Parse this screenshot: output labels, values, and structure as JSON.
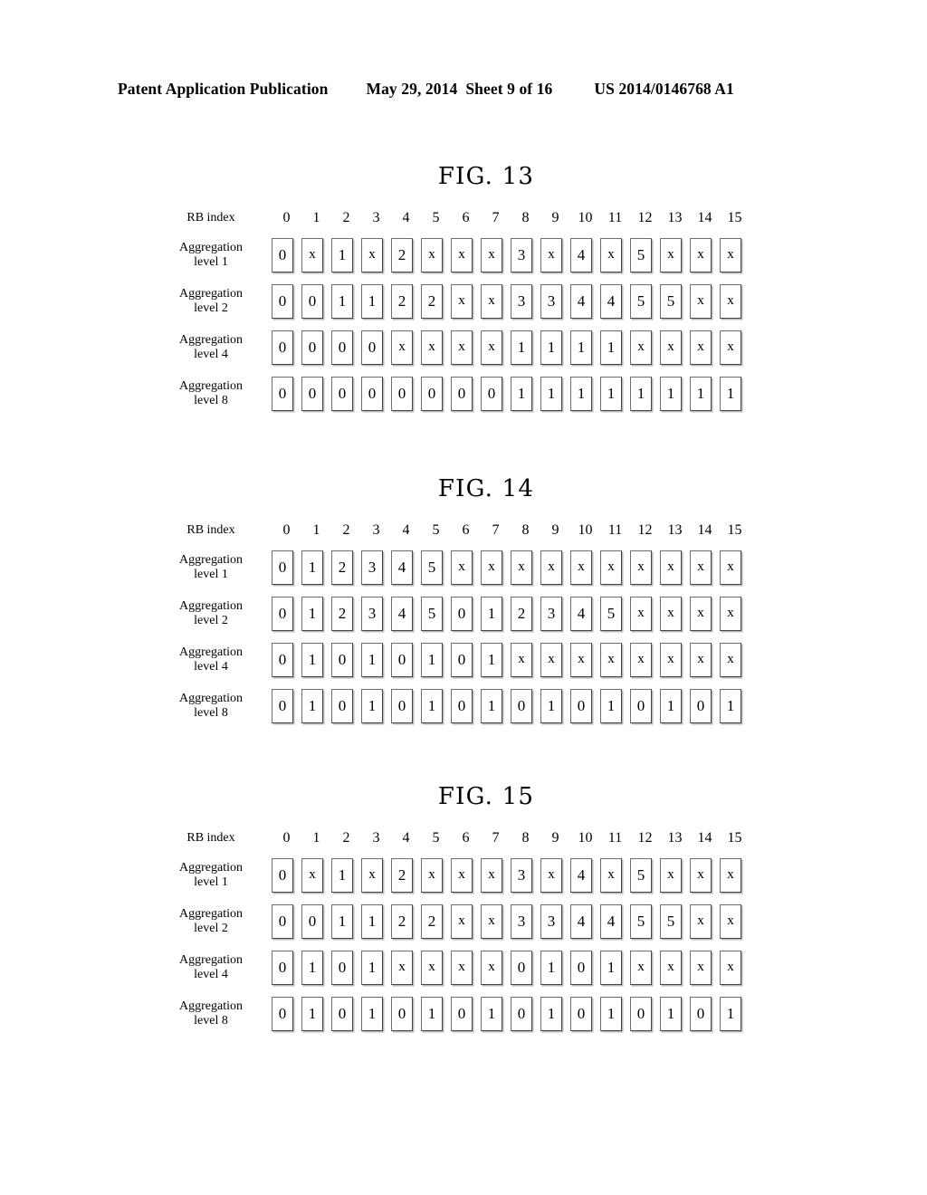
{
  "header": {
    "publication": "Patent Application Publication",
    "date": "May 29, 2014",
    "sheet": "Sheet 9 of 16",
    "patent_number": "US 2014/0146768 A1"
  },
  "common": {
    "rb_index_label": "RB index",
    "aggregation_word": "Aggregation",
    "column_headers": [
      "0",
      "1",
      "2",
      "3",
      "4",
      "5",
      "6",
      "7",
      "8",
      "9",
      "10",
      "11",
      "12",
      "13",
      "14",
      "15"
    ]
  },
  "figures": [
    {
      "id": "fig-13",
      "title": "FIG. 13",
      "rows": [
        {
          "label_line1": "Aggregation",
          "label_line2": "level 1",
          "values": [
            "0",
            "x",
            "1",
            "x",
            "2",
            "x",
            "x",
            "x",
            "3",
            "x",
            "4",
            "x",
            "5",
            "x",
            "x",
            "x"
          ]
        },
        {
          "label_line1": "Aggregation",
          "label_line2": "level 2",
          "values": [
            "0",
            "0",
            "1",
            "1",
            "2",
            "2",
            "x",
            "x",
            "3",
            "3",
            "4",
            "4",
            "5",
            "5",
            "x",
            "x"
          ]
        },
        {
          "label_line1": "Aggregation",
          "label_line2": "level 4",
          "values": [
            "0",
            "0",
            "0",
            "0",
            "x",
            "x",
            "x",
            "x",
            "1",
            "1",
            "1",
            "1",
            "x",
            "x",
            "x",
            "x"
          ]
        },
        {
          "label_line1": "Aggregation",
          "label_line2": "level 8",
          "values": [
            "0",
            "0",
            "0",
            "0",
            "0",
            "0",
            "0",
            "0",
            "1",
            "1",
            "1",
            "1",
            "1",
            "1",
            "1",
            "1"
          ]
        }
      ]
    },
    {
      "id": "fig-14",
      "title": "FIG. 14",
      "rows": [
        {
          "label_line1": "Aggregation",
          "label_line2": "level 1",
          "values": [
            "0",
            "1",
            "2",
            "3",
            "4",
            "5",
            "x",
            "x",
            "x",
            "x",
            "x",
            "x",
            "x",
            "x",
            "x",
            "x"
          ]
        },
        {
          "label_line1": "Aggregation",
          "label_line2": "level 2",
          "values": [
            "0",
            "1",
            "2",
            "3",
            "4",
            "5",
            "0",
            "1",
            "2",
            "3",
            "4",
            "5",
            "x",
            "x",
            "x",
            "x"
          ]
        },
        {
          "label_line1": "Aggregation",
          "label_line2": "level 4",
          "values": [
            "0",
            "1",
            "0",
            "1",
            "0",
            "1",
            "0",
            "1",
            "x",
            "x",
            "x",
            "x",
            "x",
            "x",
            "x",
            "x"
          ]
        },
        {
          "label_line1": "Aggregation",
          "label_line2": "level 8",
          "values": [
            "0",
            "1",
            "0",
            "1",
            "0",
            "1",
            "0",
            "1",
            "0",
            "1",
            "0",
            "1",
            "0",
            "1",
            "0",
            "1"
          ]
        }
      ]
    },
    {
      "id": "fig-15",
      "title": "FIG. 15",
      "rows": [
        {
          "label_line1": "Aggregation",
          "label_line2": "level 1",
          "values": [
            "0",
            "x",
            "1",
            "x",
            "2",
            "x",
            "x",
            "x",
            "3",
            "x",
            "4",
            "x",
            "5",
            "x",
            "x",
            "x"
          ]
        },
        {
          "label_line1": "Aggregation",
          "label_line2": "level 2",
          "values": [
            "0",
            "0",
            "1",
            "1",
            "2",
            "2",
            "x",
            "x",
            "3",
            "3",
            "4",
            "4",
            "5",
            "5",
            "x",
            "x"
          ]
        },
        {
          "label_line1": "Aggregation",
          "label_line2": "level 4",
          "values": [
            "0",
            "1",
            "0",
            "1",
            "x",
            "x",
            "x",
            "x",
            "0",
            "1",
            "0",
            "1",
            "x",
            "x",
            "x",
            "x"
          ]
        },
        {
          "label_line1": "Aggregation",
          "label_line2": "level 8",
          "values": [
            "0",
            "1",
            "0",
            "1",
            "0",
            "1",
            "0",
            "1",
            "0",
            "1",
            "0",
            "1",
            "0",
            "1",
            "0",
            "1"
          ]
        }
      ]
    }
  ]
}
